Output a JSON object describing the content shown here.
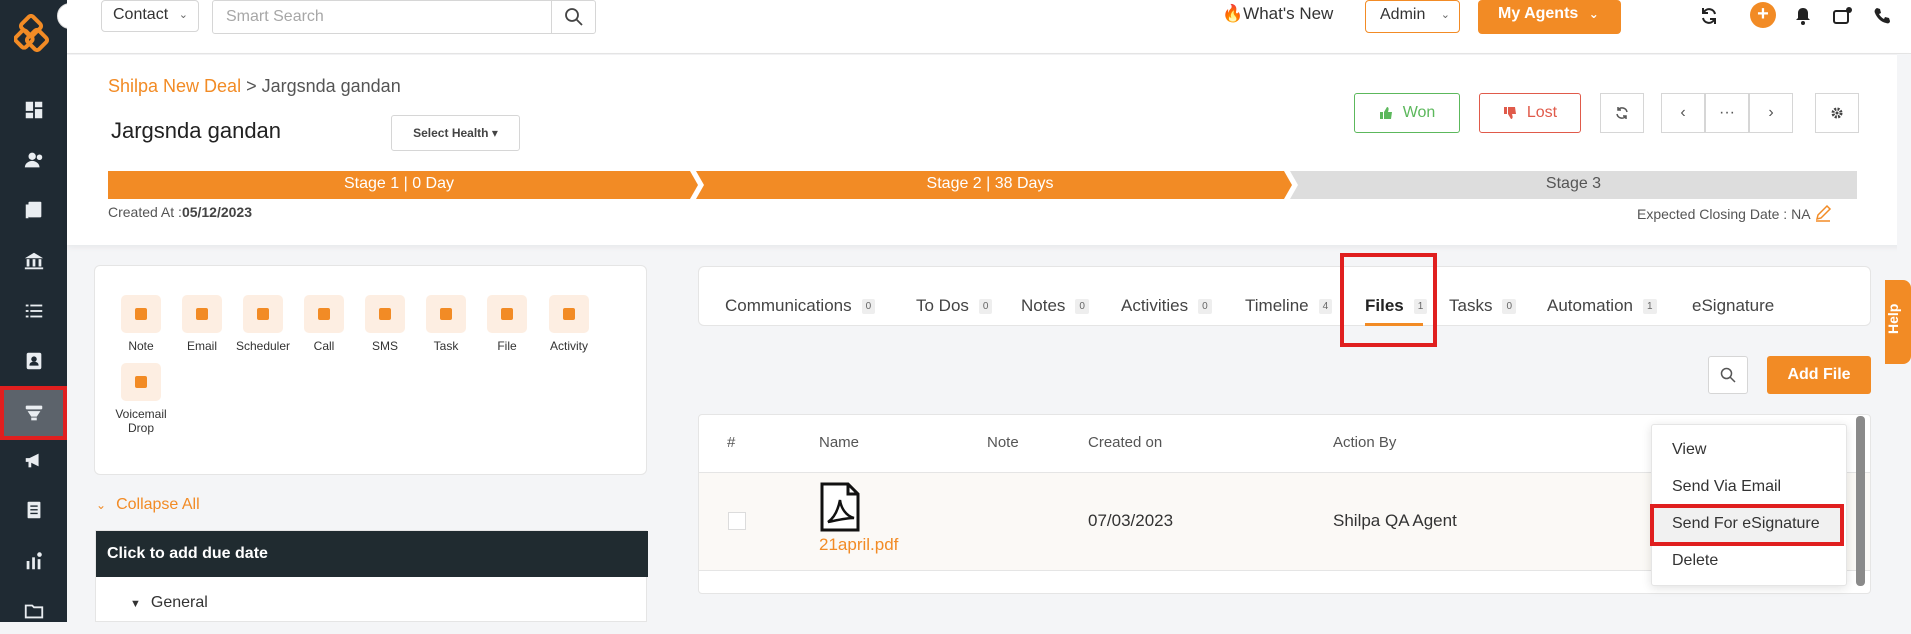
{
  "topbar": {
    "contact_select": "Contact",
    "search_placeholder": "Smart Search",
    "whats_new": "What's New",
    "admin_select": "Admin",
    "my_agents": "My Agents"
  },
  "breadcrumb": {
    "parent": "Shilpa New Deal",
    "separator": " > ",
    "current": "Jargsnda gandan"
  },
  "deal": {
    "name": "Jargsnda gandan",
    "health_button": "Select Health ▾",
    "won": "Won",
    "lost": "Lost",
    "created_label": "Created At :",
    "created_value": "05/12/2023",
    "closing_date": "Expected Closing Date : NA"
  },
  "stages": [
    {
      "label": "Stage 1 | 0 Day",
      "color": "#f28b25"
    },
    {
      "label": "Stage 2 | 38 Days",
      "color": "#f28b25"
    },
    {
      "label": "Stage 3",
      "color": "#dddddd"
    }
  ],
  "actions": [
    {
      "label": "Note"
    },
    {
      "label": "Email"
    },
    {
      "label": "Scheduler"
    },
    {
      "label": "Call"
    },
    {
      "label": "SMS"
    },
    {
      "label": "Task"
    },
    {
      "label": "File"
    },
    {
      "label": "Activity"
    },
    {
      "label": "Voicemail Drop"
    }
  ],
  "collapse_all": "Collapse All",
  "todo": {
    "header": "Click to add due date",
    "group": "General"
  },
  "tabs": [
    {
      "label": "Communications",
      "count": "0"
    },
    {
      "label": "To Dos",
      "count": "0"
    },
    {
      "label": "Notes",
      "count": "0"
    },
    {
      "label": "Activities",
      "count": "0"
    },
    {
      "label": "Timeline",
      "count": "4"
    },
    {
      "label": "Files",
      "count": "1",
      "active": true
    },
    {
      "label": "Tasks",
      "count": "0"
    },
    {
      "label": "Automation",
      "count": "1"
    },
    {
      "label": "eSignature",
      "count": ""
    }
  ],
  "add_file": "Add File",
  "table": {
    "headers": [
      "#",
      "Name",
      "Note",
      "Created on",
      "Action By"
    ],
    "rows": [
      {
        "name": "21april.pdf",
        "note": "",
        "created_on": "07/03/2023",
        "action_by": "Shilpa QA Agent"
      }
    ]
  },
  "menu": {
    "items": [
      "View",
      "Send Via Email",
      "Send For eSignature",
      "Delete"
    ]
  },
  "help": "Help",
  "colors": {
    "accent": "#f28b25",
    "rail": "#1f2a33",
    "highlight": "#e01f1f"
  }
}
